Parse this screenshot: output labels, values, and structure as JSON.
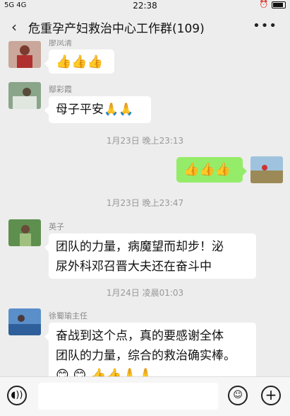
{
  "status_bar": {
    "signal": "5G 4G",
    "time": "22:38"
  },
  "header": {
    "back_icon": "chevron-left-icon",
    "title": "危重孕产妇救治中心工作群(109)",
    "more_icon": "more-icon"
  },
  "messages": [
    {
      "sender": "廖凤清",
      "content": "👍👍👍"
    },
    {
      "sender": "鄢彩霞",
      "content": "母子平安🙏🙏"
    },
    {
      "timestamp": "1月23日 晚上23:13"
    },
    {
      "sender_self": true,
      "content": "👍👍👍"
    },
    {
      "timestamp": "1月23日 晚上23:47"
    },
    {
      "sender": "英子",
      "lines": [
        "团队的力量，病魔望而却步！泌",
        "尿外科邓召晋大夫还在奋斗中"
      ]
    },
    {
      "timestamp": "1月24日 凌晨01:03"
    },
    {
      "sender": "徐蜀瑜主任",
      "lines": [
        "奋战到这个点，真的要感谢全体",
        "团队的力量，综合的救治确实棒。"
      ],
      "emoji_line": "😊 😊 👍👍🙏🙏"
    }
  ],
  "input_bar": {
    "voice_icon": "voice-icon",
    "emoji_icon": "emoji-icon",
    "plus_icon": "plus-icon"
  }
}
